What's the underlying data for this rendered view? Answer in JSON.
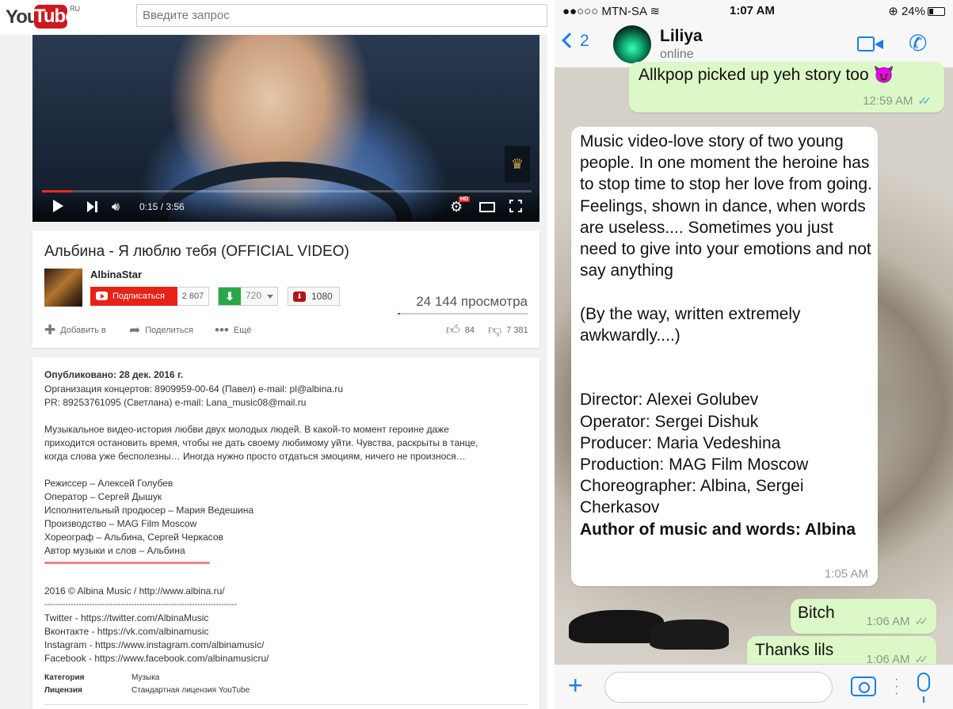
{
  "youtube": {
    "logo_you": "You",
    "logo_tube": "Tube",
    "logo_region": "RU",
    "search_placeholder": "Введите запрос",
    "player": {
      "time": "0:15 / 3:56",
      "progress_fraction": 0.063,
      "hd_badge": "HD"
    },
    "video": {
      "title": "Альбина - Я люблю тебя (OFFICIAL VIDEO)",
      "channel": "AlbinaStar",
      "subscribe_label": "Подписаться",
      "subscriber_count": "2 607",
      "download_quality": "720",
      "red_button_count": "1080",
      "views": "24 144 просмотра",
      "add_to_label": "Добавить в",
      "share_label": "Поделиться",
      "more_label": "Ещё",
      "likes": "84",
      "dislikes": "7 381"
    },
    "description": {
      "published": "Опубликовано: 28 дек. 2016 г.",
      "lines": [
        "Организация концертов: 8909959-00-64 (Павел) e-mail: pl@albina.ru",
        "PR: 89253761095 (Светлана) e-mail: Lana_music08@mail.ru",
        "Музыкальное видео-история любви двух молодых людей. В какой-то момент героине даже",
        "приходится остановить время, чтобы не дать своему любимому уйти. Чувства, раскрыты в танце,",
        "когда слова уже бесполезны… Иногда нужно просто отдаться эмоциям, ничего не произнося…",
        "Режиссер – Алексей Голубев",
        "Оператор – Сергей Дышук",
        "Исполнительный продюсер – Мария Ведешина",
        "Производство – MAG Film Moscow",
        "Хореограф – Альбина, Сергей Черкасов",
        "Автор музыки и слов – Альбина",
        "2016 © Albina Music / http://www.albina.ru/",
        "-------------------------------------------------------------------------",
        "Twitter - https://twitter.com/AlbinaMusic",
        "Вконтакте - https://vk.com/albinamusic",
        "Instagram - https://www.instagram.com/albinamusic/",
        "Facebook - https://www.facebook.com/albinamusicru/"
      ],
      "category_label": "Категория",
      "category_value": "Музыка",
      "license_label": "Лицензия",
      "license_value": "Стандартная лицензия YouTube"
    }
  },
  "whatsapp": {
    "status_bar": {
      "carrier": "●●○○○ MTN-SA",
      "time": "1:07 AM",
      "battery": "24%"
    },
    "nav": {
      "back_count": "2",
      "contact_name": "Liliya",
      "contact_status": "online"
    },
    "messages": [
      {
        "direction": "out",
        "text": "Allkpop picked up yeh story too 😈",
        "time": "12:59 AM",
        "read": true
      },
      {
        "direction": "in",
        "text": "Music video-love story of two young people. In one moment the heroine has to stop time to stop her love from going. Feelings, shown in dance, when words are useless.... Sometimes you just need to give into your emotions and not say anything\n\n(By the way, written extremely awkwardly....)\n\n\nDirector: Alexei Golubev\nOperator: Sergei Dishuk\nProducer: Maria Vedeshina\nProduction: MAG Film Moscow\nChoreographer: Albina, Sergei Cherkasov",
        "bold_line": "Author of music and words: Albina",
        "time": "1:05 AM"
      },
      {
        "direction": "out",
        "text": "Bitch",
        "time": "1:06 AM",
        "read": false
      },
      {
        "direction": "out",
        "text": "Thanks lils",
        "time": "1:06 AM",
        "read": false
      }
    ],
    "colors": {
      "accent": "#1a7ee8",
      "outgoing_bubble": "#dcf8c6",
      "incoming_bubble": "#ffffff",
      "read_ticks": "#4fa8e8"
    }
  }
}
